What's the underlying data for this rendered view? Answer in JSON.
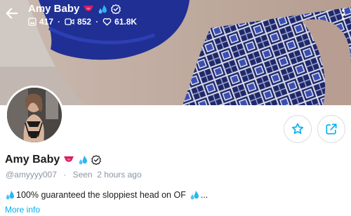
{
  "header": {
    "title": "Amy Baby",
    "stats": {
      "photos": "417",
      "videos": "852",
      "likes": "61.8K"
    }
  },
  "profile": {
    "name": "Amy Baby",
    "handle": "@amyyyy007",
    "separator": "·",
    "seen": "Seen  2 hours ago",
    "bio": "100% guaranteed the sloppiest head on OF",
    "bio_suffix": "...",
    "more_info": "More info"
  },
  "colors": {
    "accent": "#00aff0",
    "muted": "#8a96a3",
    "cover_pattern": "#2e3d8f"
  },
  "icons": {
    "back": "arrow-left-icon",
    "photos": "image-icon",
    "videos": "video-icon",
    "likes": "heart-icon",
    "menu": "more-vertical-icon",
    "favorite": "star-icon",
    "share": "share-icon",
    "verified": "verified-badge-icon",
    "tongue": "tongue-emoji",
    "droplets": "sweat-droplets-emoji"
  }
}
